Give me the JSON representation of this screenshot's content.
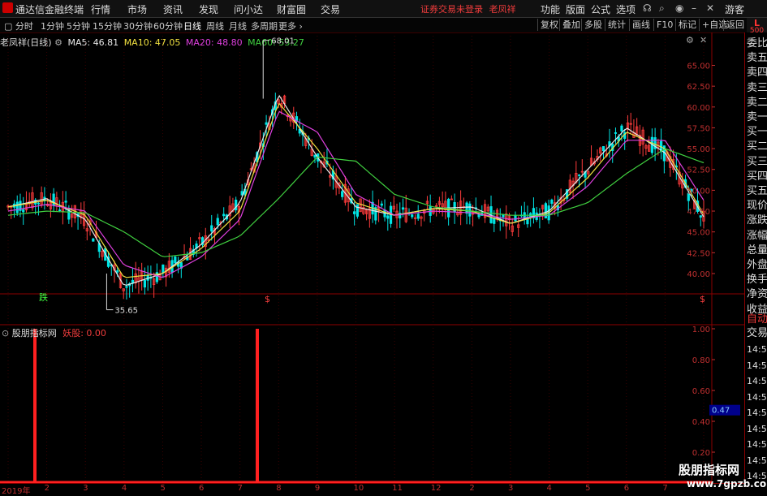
{
  "app": {
    "name": "通达信金融终端",
    "login_status": "证券交易未登录",
    "stock": "老凤祥",
    "guest": "游客"
  },
  "menu": [
    "行情",
    "市场",
    "资讯",
    "发现",
    "问小达",
    "财富圈",
    "交易"
  ],
  "right_menu": [
    "功能",
    "版面",
    "公式",
    "选项"
  ],
  "toolbar": {
    "periods": [
      "分时",
      "1分钟",
      "5分钟",
      "15分钟",
      "30分钟",
      "60分钟",
      "日线",
      "周线",
      "月线",
      "多周期",
      "更多"
    ],
    "active": "日线",
    "right": [
      "复权",
      "叠加",
      "多股",
      "统计",
      "画线",
      "F10",
      "标记",
      "+自选",
      "返回"
    ]
  },
  "badge": {
    "letter": "L",
    "num": "500"
  },
  "main_chart": {
    "label": "老凤祥(日线)",
    "ma": [
      {
        "name": "MA5",
        "value": "46.81",
        "color": "#e8e8e8"
      },
      {
        "name": "MA10",
        "value": "47.05",
        "color": "#f0e040"
      },
      {
        "name": "MA20",
        "value": "48.80",
        "color": "#e040e0"
      },
      {
        "name": "MA60",
        "value": "53.27",
        "color": "#40d040"
      }
    ],
    "y_labels": [
      "65.00",
      "62.50",
      "60.00",
      "57.50",
      "55.00",
      "52.50",
      "50.00",
      "47.50",
      "45.00",
      "42.50",
      "40.00"
    ],
    "high_label": "68.01",
    "low_label": "35.65",
    "signal_die": "跌",
    "signal_s": "$"
  },
  "sub_chart": {
    "label": "股朋指标网",
    "indicator": "妖股: 0.00",
    "y_labels": [
      "1.00",
      "0.80",
      "0.60",
      "0.40",
      "0.20"
    ],
    "marker": "0.47"
  },
  "right_panel": {
    "items": [
      "委比",
      "卖五",
      "卖四",
      "卖三",
      "卖二",
      "卖一",
      "买一",
      "买二",
      "买三",
      "买四",
      "买五",
      "现价",
      "涨跌",
      "涨幅",
      "总量",
      "外盘",
      "换手",
      "净资",
      "收益"
    ],
    "auto": "自动",
    "trade": "交易",
    "times": [
      "14:56",
      "14:56",
      "14:56",
      "14:56",
      "14:56",
      "14:56",
      "14:56",
      "14:56",
      "14:56"
    ]
  },
  "x_axis": [
    "2019年",
    "2",
    "3",
    "4",
    "5",
    "6",
    "7",
    "8",
    "9",
    "10",
    "11",
    "12",
    "2",
    "3",
    "4",
    "5",
    "6",
    "7"
  ],
  "watermark": {
    "title": "股朋指标网",
    "url": "www.7gpzb.com"
  },
  "chart_data": {
    "type": "line",
    "title": "老凤祥(日线)",
    "xlabel": "",
    "ylabel": "",
    "ylim": [
      36,
      67
    ],
    "x": [
      "2019-01",
      "2019-02",
      "2019-03",
      "2019-04",
      "2019-05",
      "2019-06",
      "2019-07",
      "2019-08",
      "2019-09",
      "2019-10",
      "2019-11",
      "2019-12",
      "2020-01",
      "2020-02",
      "2020-03",
      "2020-04",
      "2020-05",
      "2020-06",
      "2020-07"
    ],
    "series": [
      {
        "name": "MA5",
        "values": [
          48.0,
          49.0,
          46.5,
          38.5,
          40.0,
          43.5,
          48.5,
          61.5,
          54.0,
          48.0,
          47.0,
          47.8,
          48.0,
          46.0,
          47.5,
          52.5,
          57.5,
          54.5,
          46.8
        ]
      },
      {
        "name": "MA10",
        "values": [
          48.0,
          48.8,
          47.0,
          39.5,
          40.0,
          43.0,
          47.5,
          60.5,
          55.0,
          48.5,
          47.0,
          47.8,
          47.5,
          46.0,
          47.3,
          51.5,
          57.0,
          55.0,
          47.1
        ]
      },
      {
        "name": "MA20",
        "values": [
          47.5,
          48.3,
          47.5,
          41.0,
          39.5,
          42.0,
          46.5,
          59.5,
          57.0,
          49.5,
          47.0,
          47.5,
          47.3,
          46.5,
          47.0,
          50.5,
          56.0,
          56.0,
          48.8
        ]
      },
      {
        "name": "MA60",
        "values": [
          47.0,
          47.5,
          47.3,
          45.0,
          42.0,
          42.5,
          44.5,
          49.0,
          54.0,
          53.5,
          49.5,
          48.0,
          47.5,
          47.0,
          47.0,
          48.5,
          52.0,
          55.0,
          53.3
        ]
      }
    ],
    "annotations": [
      {
        "label": "68.01",
        "value": 68.01
      },
      {
        "label": "35.65",
        "value": 35.65
      }
    ],
    "sub_indicator": {
      "name": "妖股",
      "spikes_at": [
        "2019-01",
        "2019-07"
      ],
      "value": 1.0
    }
  }
}
